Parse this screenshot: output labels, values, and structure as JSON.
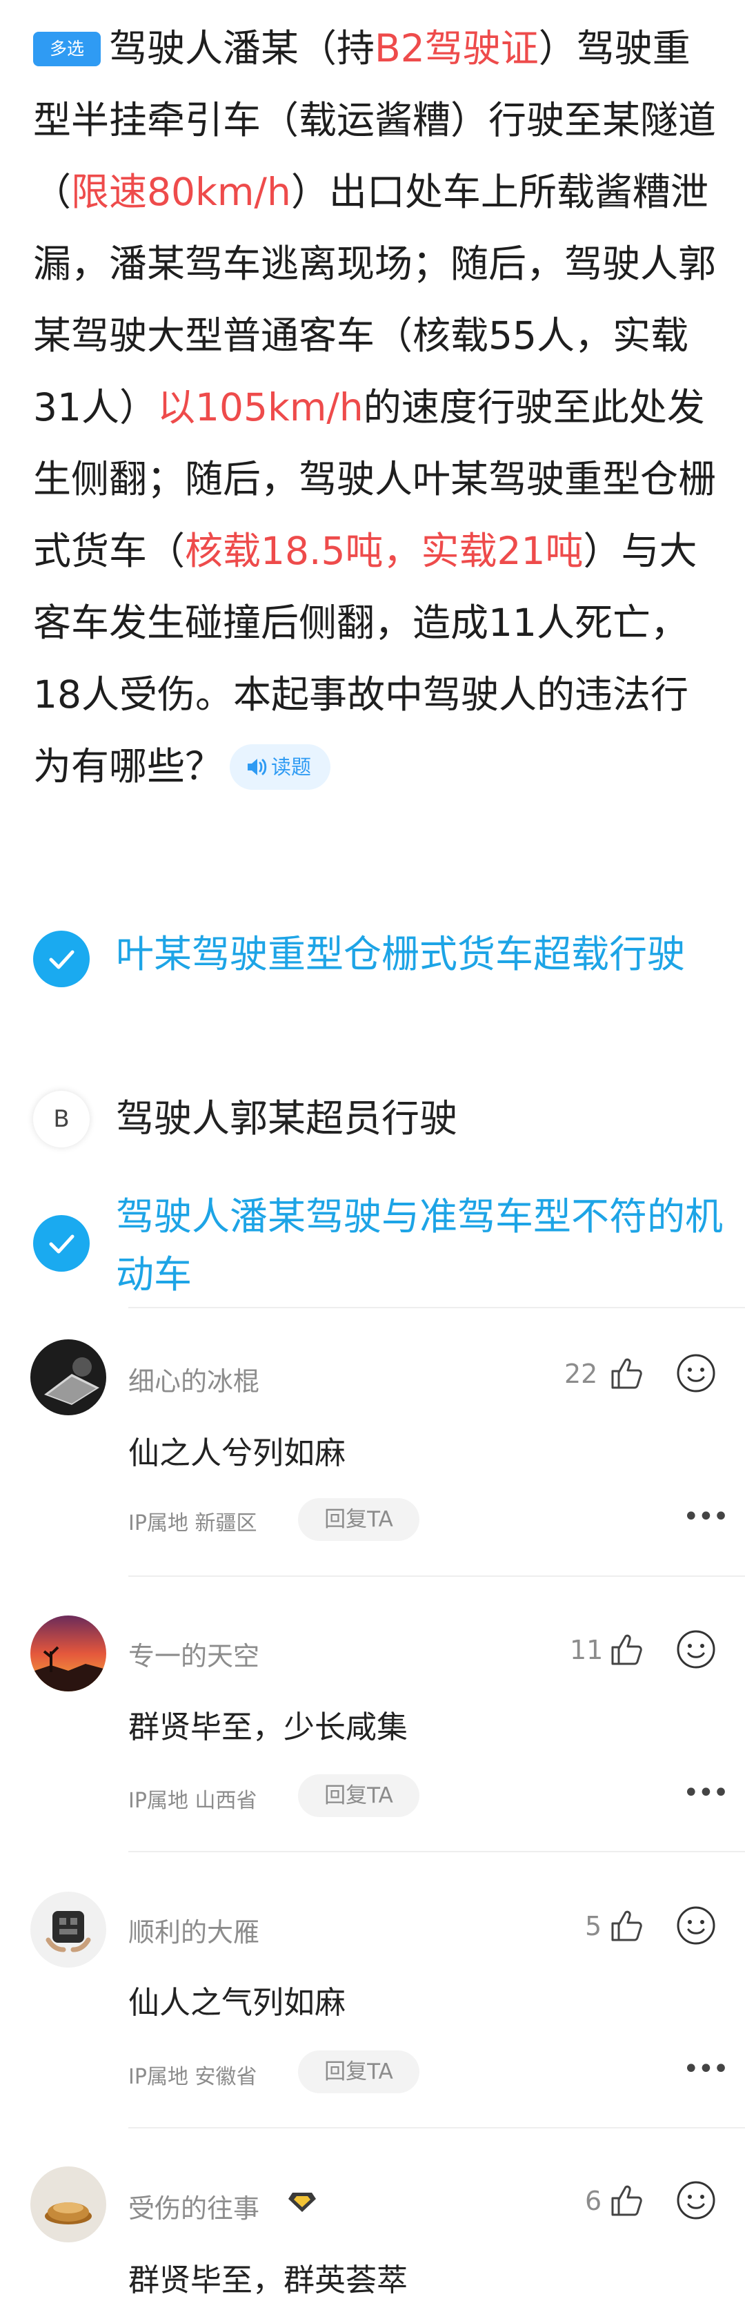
{
  "question": {
    "tag": "多选",
    "segments": [
      {
        "text": "驾驶人潘某（持",
        "color": "normal"
      },
      {
        "text": "B2驾驶证",
        "color": "red"
      },
      {
        "text": "）驾驶重型半挂牵引车（载运酱糟）行驶至某隧道（",
        "color": "normal"
      },
      {
        "text": "限速80km/h",
        "color": "red"
      },
      {
        "text": "）出口处车上所载酱糟泄漏，潘某驾车逃离现场；随后，驾驶人郭某驾驶大型普通客车（核载55人，实载31人）",
        "color": "normal"
      },
      {
        "text": "以105km/h",
        "color": "red"
      },
      {
        "text": "的速度行驶至此处发生侧翻；随后，驾驶人叶某驾驶重型仓栅式货车（",
        "color": "normal"
      },
      {
        "text": "核载18.5吨，实载21吨",
        "color": "red"
      },
      {
        "text": "）与大客车发生碰撞后侧翻，造成11人死亡，18人受伤。本起事故中驾驶人的违法行为有哪些？",
        "color": "normal"
      }
    ],
    "read_button": "读题"
  },
  "options": [
    {
      "marker": "check",
      "text": "叶某驾驶重型仓栅式货车超载行驶",
      "correct": true
    },
    {
      "marker": "B",
      "text": "驾驶人郭某超员行驶",
      "correct": false
    },
    {
      "marker": "check",
      "text": "驾驶人潘某驾驶与准驾车型不符的机动车",
      "correct": true
    }
  ],
  "comments": [
    {
      "name": "细心的冰棍",
      "likes": "22",
      "text": "仙之人兮列如麻",
      "ip": "IP属地 新疆区",
      "reply": "回复TA"
    },
    {
      "name": "专一的天空",
      "likes": "11",
      "text": "群贤毕至，少长咸集",
      "ip": "IP属地 山西省",
      "reply": "回复TA"
    },
    {
      "name": "顺利的大雁",
      "likes": "5",
      "text": "仙人之气列如麻",
      "ip": "IP属地 安徽省",
      "reply": "回复TA"
    },
    {
      "name": "受伤的往事",
      "likes": "6",
      "text": "群贤毕至，群英荟萃",
      "ip": "",
      "reply": ""
    }
  ],
  "colors": {
    "accent": "#1aaaf0",
    "red": "#ee4b4b",
    "tag": "#2f9bf3"
  },
  "icons": {
    "check": "check-icon",
    "like": "thumbs-up-icon",
    "react": "smiley-icon",
    "more": "more-dots-icon",
    "speaker": "speaker-icon",
    "badge": "diamond-badge-icon"
  }
}
